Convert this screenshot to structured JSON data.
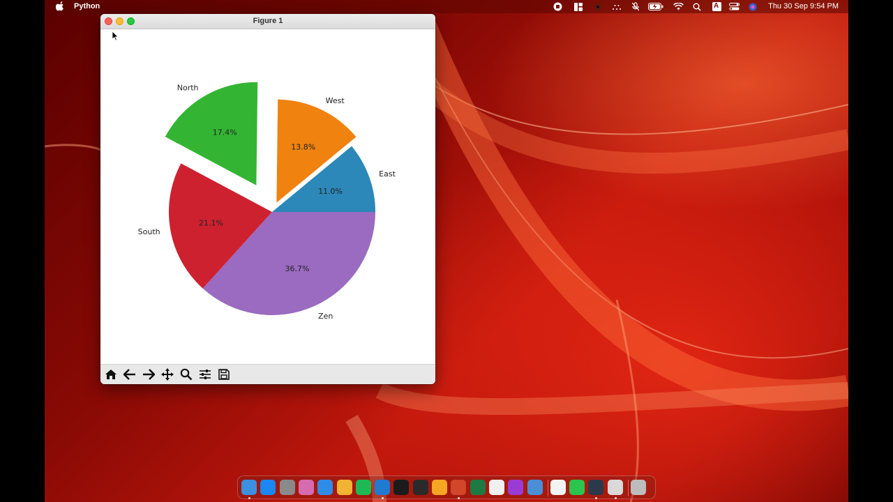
{
  "menubar": {
    "app_name": "Python",
    "clock": "Thu 30 Sep  9:54 PM",
    "status_icons": [
      "screen-record-icon",
      "window-layout-icon",
      "camera-icon",
      "dots-icon",
      "mic-off-icon",
      "battery-icon",
      "wifi-icon",
      "spotlight-icon",
      "input-source-icon",
      "control-center-icon",
      "siri-icon"
    ],
    "input_source_label": "A"
  },
  "window": {
    "title": "Figure 1",
    "toolbar": {
      "buttons": [
        "home-icon",
        "back-icon",
        "forward-icon",
        "pan-icon",
        "zoom-icon",
        "configure-subplots-icon",
        "save-icon"
      ]
    }
  },
  "chart_data": {
    "type": "pie",
    "title": "",
    "start_angle_deg": 0,
    "direction": "counterclockwise",
    "slices": [
      {
        "label": "East",
        "value": 11.0,
        "pct_label": "11.0%",
        "color": "#2b88b8",
        "explode": 0
      },
      {
        "label": "West",
        "value": 13.8,
        "pct_label": "13.8%",
        "color": "#f0820f",
        "explode": 0.1
      },
      {
        "label": "North",
        "value": 17.4,
        "pct_label": "17.4%",
        "color": "#33b533",
        "explode": 0.3
      },
      {
        "label": "South",
        "value": 21.1,
        "pct_label": "21.1%",
        "color": "#cd2130",
        "explode": 0
      },
      {
        "label": "Zen",
        "value": 36.7,
        "pct_label": "36.7%",
        "color": "#9a6bc0",
        "explode": 0
      }
    ]
  },
  "dock": {
    "apps": [
      {
        "name": "finder-icon",
        "color": "#3d8fe0",
        "running": true
      },
      {
        "name": "app-store-icon",
        "color": "#1c87f0",
        "running": false
      },
      {
        "name": "system-preferences-icon",
        "color": "#8a8a8a",
        "running": false
      },
      {
        "name": "launchpad-icon",
        "color": "#d76bb0",
        "running": false
      },
      {
        "name": "safari-icon",
        "color": "#2f8ce6",
        "running": false
      },
      {
        "name": "photos-icon",
        "color": "#f2b233",
        "running": false
      },
      {
        "name": "spotify-icon",
        "color": "#1db954",
        "running": false
      },
      {
        "name": "vscode-icon",
        "color": "#1f7ad0",
        "running": true
      },
      {
        "name": "terminal-icon",
        "color": "#1b1b1b",
        "running": false
      },
      {
        "name": "console-icon",
        "color": "#2a2a2a",
        "running": false
      },
      {
        "name": "home-app-icon",
        "color": "#f5a623",
        "running": false
      },
      {
        "name": "powerpoint-icon",
        "color": "#d2472a",
        "running": true
      },
      {
        "name": "excel-icon",
        "color": "#1e7a44",
        "running": false
      },
      {
        "name": "word-icon",
        "color": "#f0f0f0",
        "running": false
      },
      {
        "name": "feedback-icon",
        "color": "#9b3bd6",
        "running": false
      },
      {
        "name": "xcode-icon",
        "color": "#4a8ed8",
        "running": false
      },
      {
        "name": "paintbrush-icon",
        "color": "#f3f3f3",
        "running": false
      },
      {
        "name": "facetime-icon",
        "color": "#2bc44f",
        "running": false
      },
      {
        "name": "quicktime-icon",
        "color": "#2b3a4a",
        "running": true
      },
      {
        "name": "python-rocket-icon",
        "color": "#d9d9d9",
        "running": true
      },
      {
        "name": "trash-icon",
        "color": "#bcbcbc",
        "running": false
      }
    ]
  }
}
